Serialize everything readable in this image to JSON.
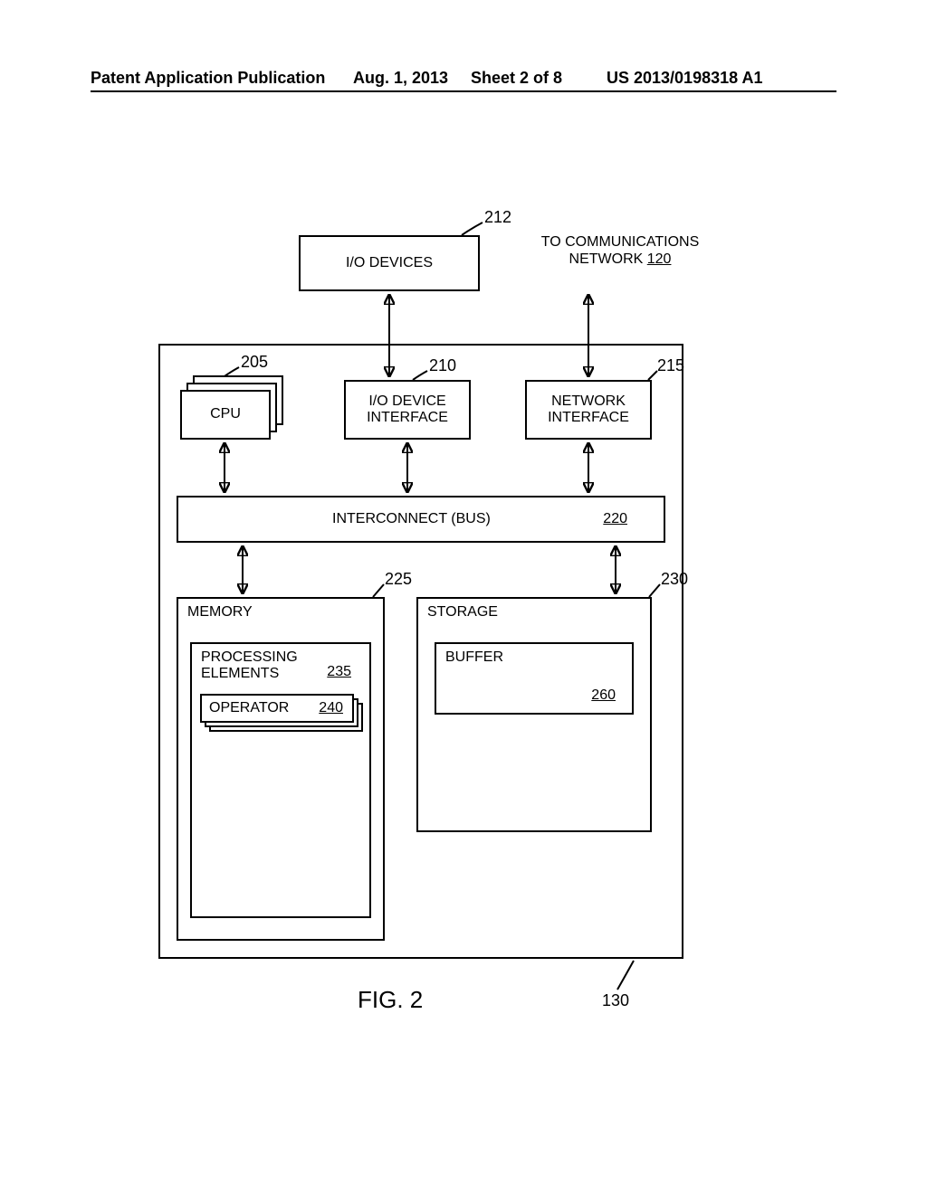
{
  "header": {
    "publication": "Patent Application Publication",
    "date": "Aug. 1, 2013",
    "sheet": "Sheet 2 of 8",
    "docno": "US 2013/0198318 A1"
  },
  "fig_caption": "FIG. 2",
  "labels": {
    "io_devices": "I/O DEVICES",
    "to_comm": "TO\nCOMMUNICATIONS\nNETWORK  ",
    "comm_ref": "120",
    "cpu": "CPU",
    "io_if": "I/O DEVICE\nINTERFACE",
    "net_if": "NETWORK\nINTERFACE",
    "bus": "INTERCONNECT (BUS)",
    "bus_ref": "220",
    "memory_title": "MEMORY",
    "processing_elements": "PROCESSING\nELEMENTS",
    "pe_ref": "235",
    "operator": "OPERATOR",
    "operator_ref": "240",
    "storage_title": "STORAGE",
    "buffer": "BUFFER",
    "buffer_ref": "260"
  },
  "leads": {
    "io_devices_ref": "212",
    "cpu_ref": "205",
    "io_if_ref": "210",
    "net_if_ref": "215",
    "memory_ref": "225",
    "storage_ref": "230",
    "outer_ref": "130"
  }
}
